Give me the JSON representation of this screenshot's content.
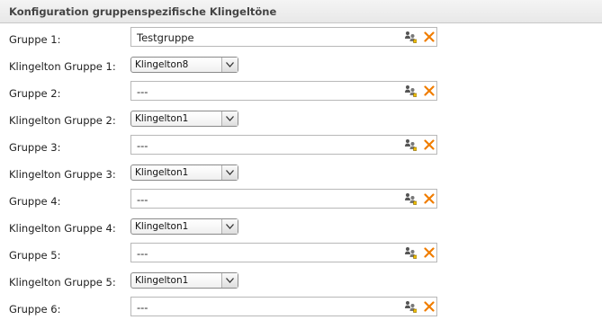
{
  "panel": {
    "title": "Konfiguration gruppenspezifische Klingeltöne"
  },
  "rows": [
    {
      "kind": "group",
      "label": "Gruppe 1:",
      "value": "Testgruppe"
    },
    {
      "kind": "ring",
      "label": "Klingelton Gruppe 1:",
      "value": "Klingelton8"
    },
    {
      "kind": "group",
      "label": "Gruppe 2:",
      "value": "---"
    },
    {
      "kind": "ring",
      "label": "Klingelton Gruppe 2:",
      "value": "Klingelton1"
    },
    {
      "kind": "group",
      "label": "Gruppe 3:",
      "value": "---"
    },
    {
      "kind": "ring",
      "label": "Klingelton Gruppe 3:",
      "value": "Klingelton1"
    },
    {
      "kind": "group",
      "label": "Gruppe 4:",
      "value": "---"
    },
    {
      "kind": "ring",
      "label": "Klingelton Gruppe 4:",
      "value": "Klingelton1"
    },
    {
      "kind": "group",
      "label": "Gruppe 5:",
      "value": "---"
    },
    {
      "kind": "ring",
      "label": "Klingelton Gruppe 5:",
      "value": "Klingelton1"
    },
    {
      "kind": "group",
      "label": "Gruppe 6:",
      "value": "---"
    }
  ],
  "icons": {
    "picker": "group-picker-icon",
    "clear": "clear-x-icon"
  },
  "colors": {
    "clear_accent": "#f07d00",
    "header_bg": "#ececec",
    "border": "#b8b8b8"
  }
}
